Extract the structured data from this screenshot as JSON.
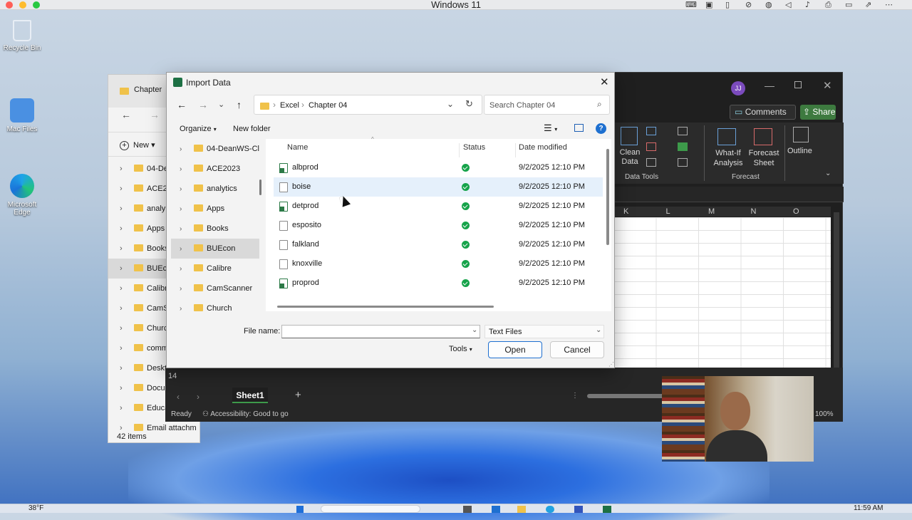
{
  "os": {
    "title": "Windows 11"
  },
  "desktop": {
    "icons": [
      {
        "label": "Recycle Bin",
        "icon": "recycle-bin-icon"
      },
      {
        "label": "Mac Files",
        "icon": "mac-files-icon"
      },
      {
        "label": "Microsoft Edge",
        "icon": "edge-icon"
      }
    ]
  },
  "explorer": {
    "tab_title": "Chapter",
    "new_label": "New",
    "nav_items": [
      "04-De",
      "ACE20",
      "analy",
      "Apps",
      "Books",
      "BUEco",
      "Calibr",
      "CamS",
      "Churc",
      "comm",
      "Deskt",
      "Docu",
      "Educa",
      "Email attachm"
    ],
    "selected_index": 5,
    "status": "42 items"
  },
  "excel": {
    "avatar": "JJ",
    "comments_label": "Comments",
    "share_label": "Share",
    "ribbon": {
      "clean_data": "Clean Data",
      "data_tools_group": "Data Tools",
      "what_if": "What-If Analysis",
      "forecast_sheet": "Forecast Sheet",
      "forecast_group": "Forecast",
      "outline": "Outline"
    },
    "columns": [
      "K",
      "L",
      "M",
      "N",
      "O"
    ],
    "row_14": "14",
    "sheet_tab": "Sheet1",
    "status_ready": "Ready",
    "accessibility": "Accessibility: Good to go",
    "zoom": "100%"
  },
  "dialog": {
    "title": "Import Data",
    "breadcrumb": [
      "Excel",
      "Chapter 04"
    ],
    "search_placeholder": "Search Chapter 04",
    "organize_label": "Organize",
    "new_folder_label": "New folder",
    "nav_items": [
      "04-DeanWS-Cl",
      "ACE2023",
      "analytics",
      "Apps",
      "Books",
      "BUEcon",
      "Calibre",
      "CamScanner",
      "Church"
    ],
    "nav_selected_index": 5,
    "columns": {
      "name": "Name",
      "status": "Status",
      "date": "Date modified"
    },
    "files": [
      {
        "name": "albprod",
        "date": "9/2/2025 12:10 PM",
        "excel": true
      },
      {
        "name": "boise",
        "date": "9/2/2025 12:10 PM",
        "excel": false
      },
      {
        "name": "detprod",
        "date": "9/2/2025 12:10 PM",
        "excel": true
      },
      {
        "name": "esposito",
        "date": "9/2/2025 12:10 PM",
        "excel": false
      },
      {
        "name": "falkland",
        "date": "9/2/2025 12:10 PM",
        "excel": false
      },
      {
        "name": "knoxville",
        "date": "9/2/2025 12:10 PM",
        "excel": false
      },
      {
        "name": "proprod",
        "date": "9/2/2025 12:10 PM",
        "excel": true
      }
    ],
    "hovered_index": 1,
    "file_name_label": "File name:",
    "file_name_value": "",
    "file_type": "Text Files",
    "tools_label": "Tools",
    "open_label": "Open",
    "cancel_label": "Cancel"
  },
  "taskbar": {
    "weather": "38°F",
    "time": "11:59 AM"
  }
}
